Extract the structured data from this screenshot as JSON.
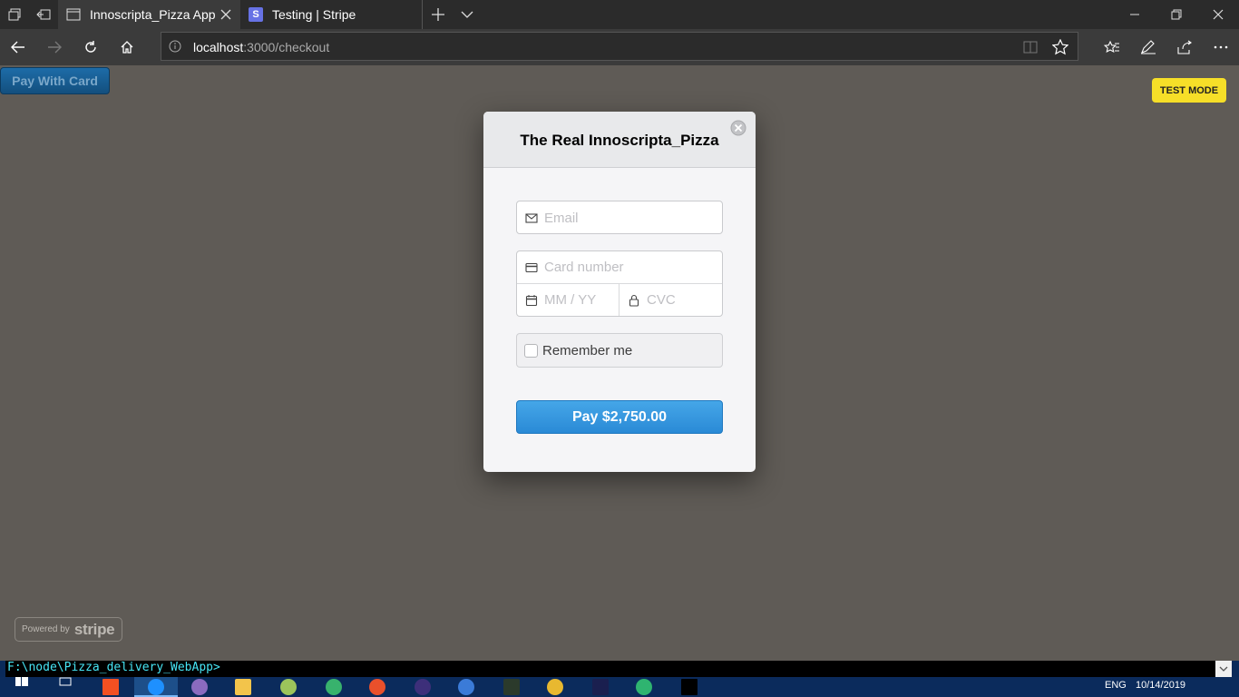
{
  "browser": {
    "tabs": [
      {
        "title": "Innoscripta_Pizza App"
      },
      {
        "title": "Testing | Stripe",
        "favicon_letter": "S"
      }
    ],
    "address": {
      "host": "localhost",
      "path": ":3000/checkout"
    }
  },
  "page": {
    "pay_with_card_label": "Pay With Card",
    "test_mode_label": "TEST MODE",
    "powered_by_label": "Powered by",
    "stripe_label": "stripe"
  },
  "checkout": {
    "title": "The Real Innoscripta_Pizza",
    "email_placeholder": "Email",
    "card_number_placeholder": "Card number",
    "expiry_placeholder": "MM / YY",
    "cvc_placeholder": "CVC",
    "remember_label": "Remember me",
    "pay_button_label": "Pay $2,750.00"
  },
  "console": {
    "prompt": "F:\\node\\Pizza_delivery_WebApp>"
  },
  "taskbar": {
    "lang": "ENG",
    "date": "10/14/2019"
  },
  "colors": {
    "pay_button": "#2a8ad6",
    "test_mode": "#f6df28",
    "overlay": "#5f5b56"
  }
}
